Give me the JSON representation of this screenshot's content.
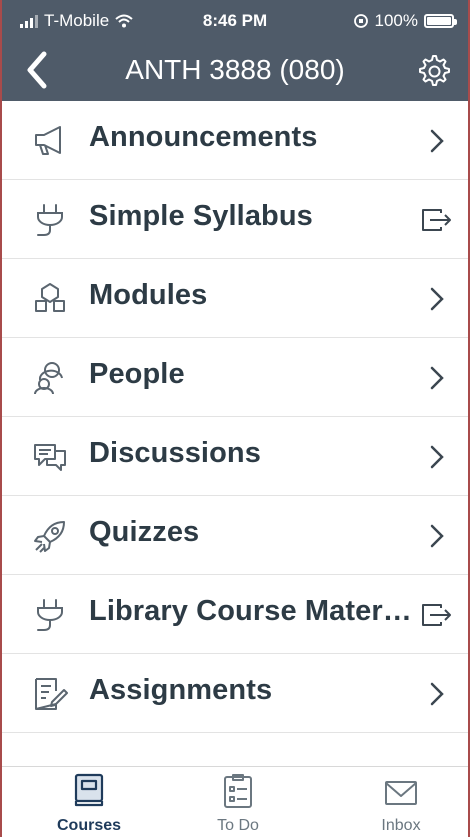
{
  "status_bar": {
    "carrier": "T-Mobile",
    "time": "8:46 PM",
    "battery": "100%"
  },
  "nav": {
    "title": "ANTH 3888 (080)"
  },
  "menu": {
    "items": [
      {
        "label": "Announcements",
        "icon": "megaphone-icon",
        "trail": "chevron-right-icon"
      },
      {
        "label": "Simple Syllabus",
        "icon": "plug-icon",
        "trail": "external-link-icon"
      },
      {
        "label": "Modules",
        "icon": "modules-icon",
        "trail": "chevron-right-icon"
      },
      {
        "label": "People",
        "icon": "people-icon",
        "trail": "chevron-right-icon"
      },
      {
        "label": "Discussions",
        "icon": "discussions-icon",
        "trail": "chevron-right-icon"
      },
      {
        "label": "Quizzes",
        "icon": "rocket-icon",
        "trail": "chevron-right-icon"
      },
      {
        "label": "Library Course Mater…",
        "icon": "plug-icon",
        "trail": "external-link-icon"
      },
      {
        "label": "Assignments",
        "icon": "assignment-icon",
        "trail": "chevron-right-icon"
      }
    ]
  },
  "tabs": {
    "courses": "Courses",
    "todo": "To Do",
    "inbox": "Inbox"
  },
  "colors": {
    "header_bg": "#4f5b69",
    "text": "#2d3b45",
    "active_tab": "#1f3b5b"
  }
}
